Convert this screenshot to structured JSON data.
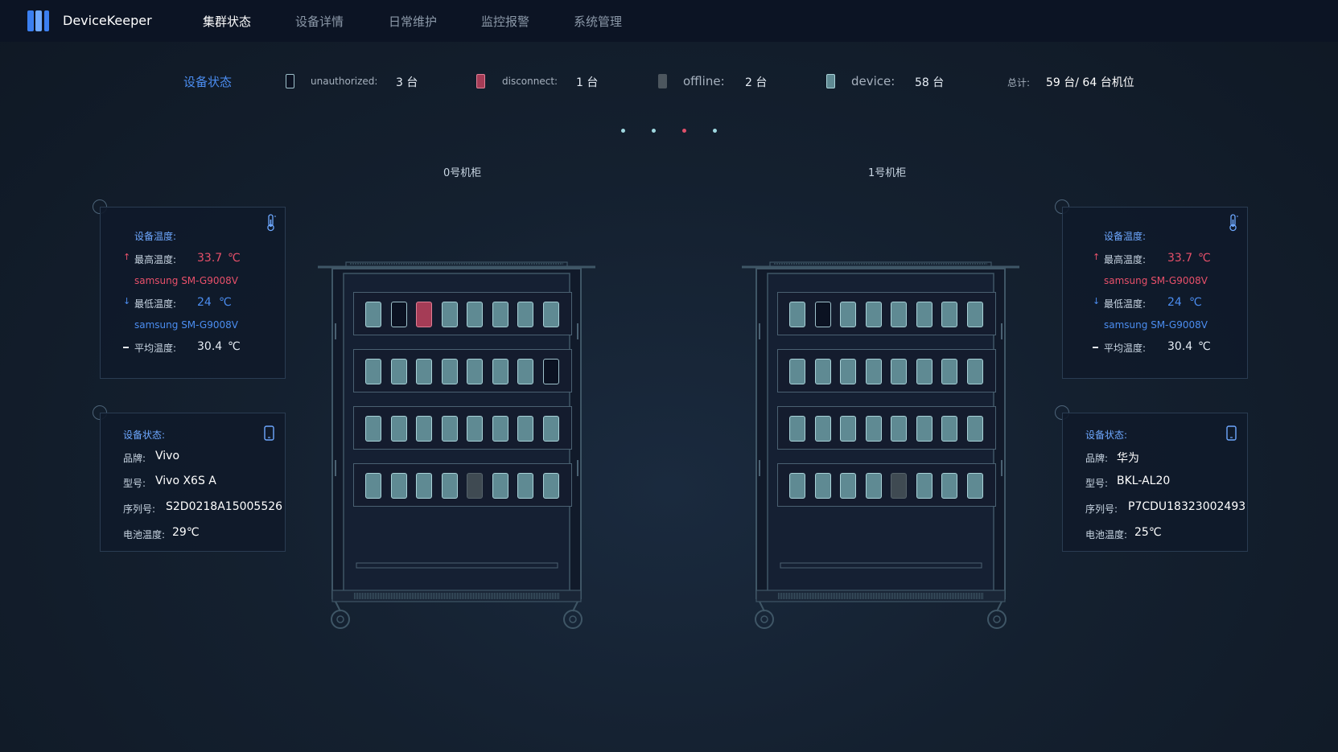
{
  "app": {
    "title": "DeviceKeeper"
  },
  "nav": [
    {
      "label": "集群状态",
      "active": true
    },
    {
      "label": "设备详情",
      "active": false
    },
    {
      "label": "日常维护",
      "active": false
    },
    {
      "label": "监控报警",
      "active": false
    },
    {
      "label": "系统管理",
      "active": false
    }
  ],
  "status": {
    "title": "设备状态",
    "items": [
      {
        "key": "unauthorized",
        "label": "unauthorized:",
        "count": "3 台",
        "color": "#0b1222"
      },
      {
        "key": "disconnect",
        "label": "disconnect:",
        "count": "1 台",
        "color": "#a53c56"
      },
      {
        "key": "offline",
        "label": "offline:",
        "count": "2 台",
        "color": "#3f4a52"
      },
      {
        "key": "device",
        "label": "device:",
        "count": "58 台",
        "color": "#5f8a93"
      }
    ],
    "total_label": "总计:",
    "total_value": "59 台/ 64 台机位"
  },
  "pager": {
    "count": 4,
    "active_index": 2
  },
  "cabinets": [
    {
      "label": "0号机柜",
      "shelves": [
        [
          "device",
          "unauthorized",
          "disconnect",
          "device",
          "device",
          "device",
          "device",
          "device"
        ],
        [
          "device",
          "device",
          "device",
          "device",
          "device",
          "device",
          "device",
          "unauthorized"
        ],
        [
          "device",
          "device",
          "device",
          "device",
          "device",
          "device",
          "device",
          "device"
        ],
        [
          "device",
          "device",
          "device",
          "device",
          "offline",
          "device",
          "device",
          "device"
        ]
      ]
    },
    {
      "label": "1号机柜",
      "shelves": [
        [
          "device",
          "unauthorized",
          "device",
          "device",
          "device",
          "device",
          "device",
          "device"
        ],
        [
          "device",
          "device",
          "device",
          "device",
          "device",
          "device",
          "device",
          "device"
        ],
        [
          "device",
          "device",
          "device",
          "device",
          "device",
          "device",
          "device",
          "device"
        ],
        [
          "device",
          "device",
          "device",
          "device",
          "offline",
          "device",
          "device",
          "device"
        ]
      ]
    }
  ],
  "temp_cards": [
    {
      "heading": "设备温度:",
      "max_label": "最高温度:",
      "max_value": "33.7",
      "max_unit": "℃",
      "max_device": "samsung SM-G9008V",
      "min_label": "最低温度:",
      "min_value": "24",
      "min_unit": "℃",
      "min_device": "samsung SM-G9008V",
      "avg_label": "平均温度:",
      "avg_value": "30.4",
      "avg_unit": "℃",
      "icon": "thermometer-icon"
    },
    {
      "heading": "设备温度:",
      "max_label": "最高温度:",
      "max_value": "33.7",
      "max_unit": "℃",
      "max_device": "samsung SM-G9008V",
      "min_label": "最低温度:",
      "min_value": "24",
      "min_unit": "℃",
      "min_device": "samsung SM-G9008V",
      "avg_label": "平均温度:",
      "avg_value": "30.4",
      "avg_unit": "℃",
      "icon": "thermometer-icon"
    }
  ],
  "device_cards": [
    {
      "heading": "设备状态:",
      "brand_label": "品牌:",
      "brand": "Vivo",
      "model_label": "型号:",
      "model": "Vivo X6S A",
      "serial_label": "序列号:",
      "serial": "S2D0218A15005526",
      "battery_label": "电池温度:",
      "battery": "29℃",
      "icon": "phone-icon"
    },
    {
      "heading": "设备状态:",
      "brand_label": "品牌:",
      "brand": "华为",
      "model_label": "型号:",
      "model": "BKL-AL20",
      "serial_label": "序列号:",
      "serial": "P7CDU18323002493",
      "battery_label": "电池温度:",
      "battery": "25℃",
      "icon": "phone-icon"
    }
  ]
}
